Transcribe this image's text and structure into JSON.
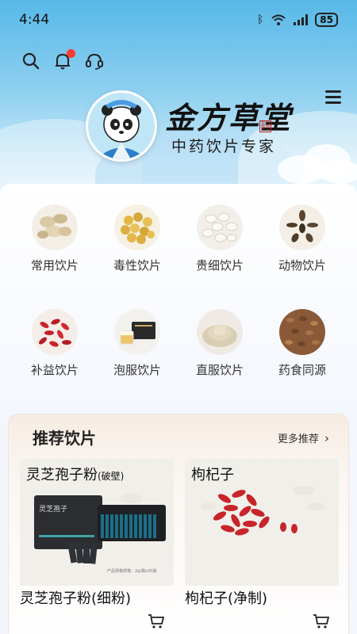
{
  "status": {
    "time": "4:44",
    "battery": "85"
  },
  "brand": {
    "name": "金方草堂",
    "subtitle": "中药饮片专家",
    "seal": "金方草堂"
  },
  "categories": [
    {
      "label": "常用饮片",
      "icon": "sliced-herb-icon"
    },
    {
      "label": "毒性饮片",
      "icon": "yellow-seeds-icon"
    },
    {
      "label": "贵细饮片",
      "icon": "white-slices-icon"
    },
    {
      "label": "动物饮片",
      "icon": "insects-icon"
    },
    {
      "label": "补益饮片",
      "icon": "goji-berries-icon"
    },
    {
      "label": "泡服饮片",
      "icon": "tea-box-icon"
    },
    {
      "label": "直服饮片",
      "icon": "powder-icon"
    },
    {
      "label": "药食同源",
      "icon": "grains-icon"
    }
  ],
  "recommend": {
    "title": "推荐饮片",
    "more": "更多推荐",
    "items": [
      {
        "image_title": "灵芝孢子粉",
        "image_tag": "(破壁)",
        "name": "灵芝孢子粉(细粉)",
        "box_text": "灵芝孢子",
        "spec": "产品规格规格：2g/袋x20袋"
      },
      {
        "image_title": "枸杞子",
        "image_tag": "",
        "name": "枸杞子(净制)"
      }
    ]
  },
  "colors": {
    "sky": "#58b9e8",
    "notification": "#ff3b30",
    "goji": "#c8242b"
  }
}
